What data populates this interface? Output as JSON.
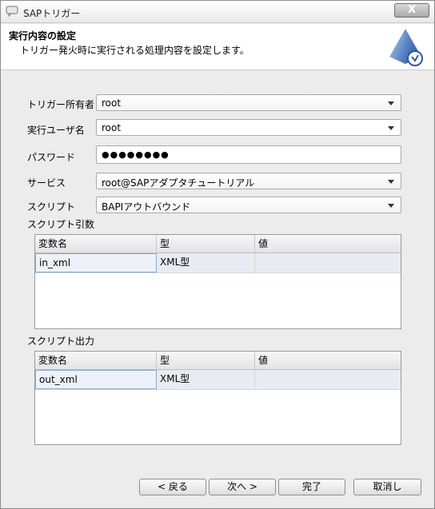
{
  "window": {
    "title": "SAPトリガー",
    "close_label": "X"
  },
  "header": {
    "title": "実行内容の設定",
    "description": "トリガー発火時に実行される処理内容を設定します。"
  },
  "form": {
    "owner": {
      "label": "トリガー所有者",
      "value": "root"
    },
    "exec_user": {
      "label": "実行ユーザ名",
      "value": "root"
    },
    "password": {
      "label": "パスワード",
      "value": "●●●●●●●●"
    },
    "service": {
      "label": "サービス",
      "value": "root@SAPアダプタチュートリアル"
    },
    "script": {
      "label": "スクリプト",
      "value": "BAPIアウトバウンド"
    }
  },
  "script_args": {
    "label": "スクリプト引数",
    "columns": [
      "変数名",
      "型",
      "値"
    ],
    "rows": [
      {
        "name": "in_xml",
        "type": "XML型",
        "value": ""
      }
    ]
  },
  "script_output": {
    "label": "スクリプト出力",
    "columns": [
      "変数名",
      "型",
      "値"
    ],
    "rows": [
      {
        "name": "out_xml",
        "type": "XML型",
        "value": ""
      }
    ]
  },
  "buttons": {
    "back": "< 戻る",
    "next": "次へ >",
    "finish": "完了",
    "cancel": "取消し"
  },
  "colors": {
    "accent_blue": "#3f6fb5",
    "selection_border": "#8aa9c8"
  }
}
